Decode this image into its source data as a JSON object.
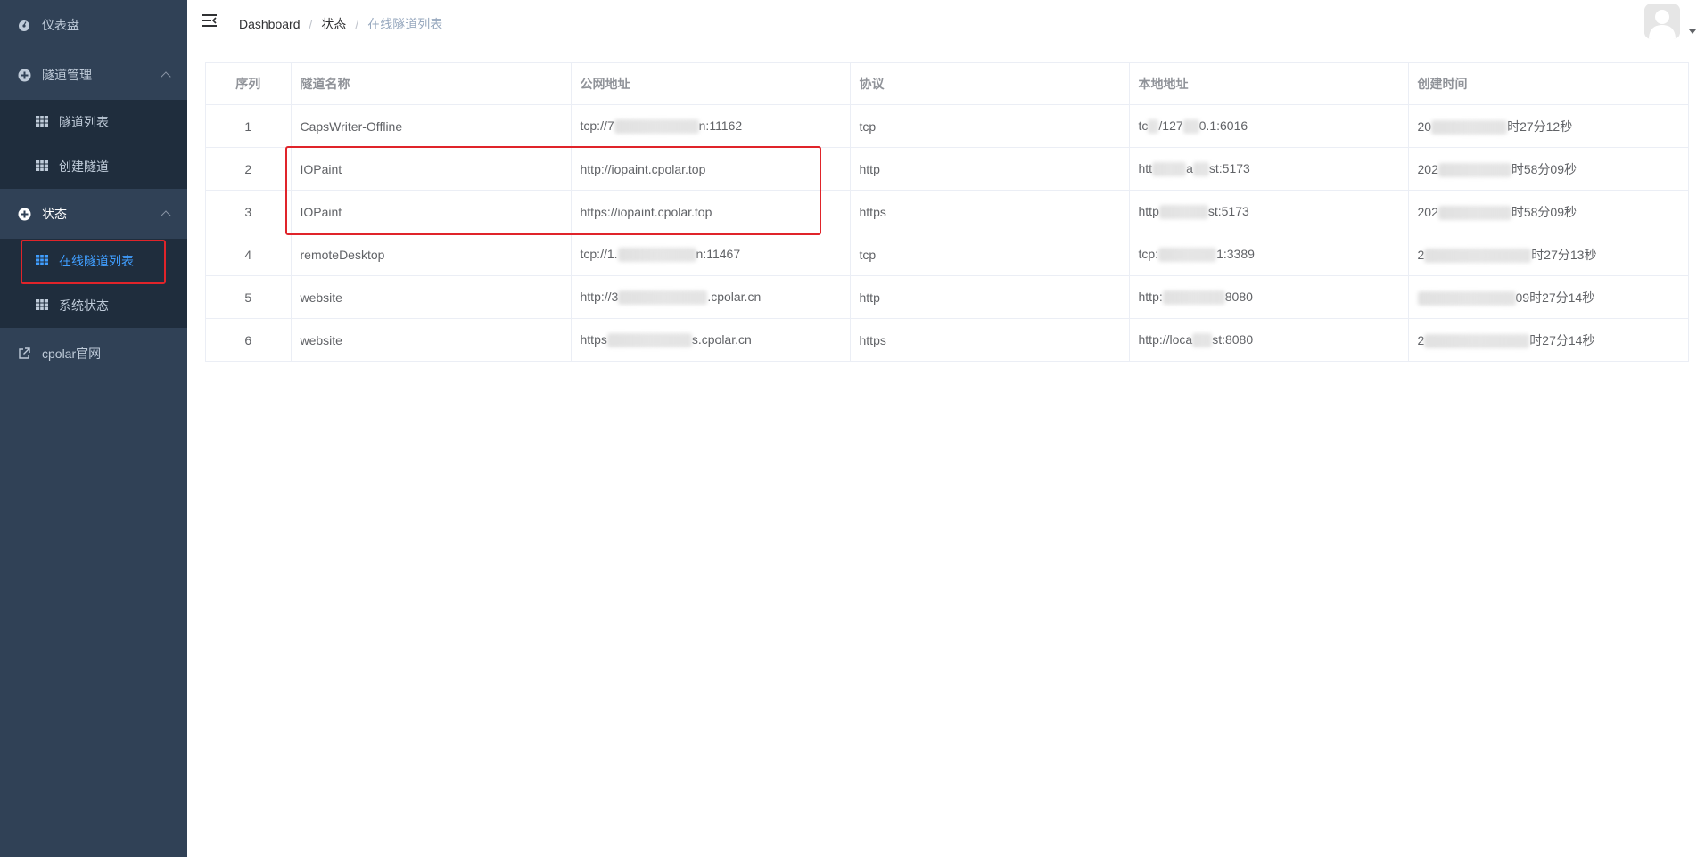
{
  "sidebar": {
    "items": [
      {
        "label": "仪表盘",
        "icon": "dashboard-icon"
      },
      {
        "label": "隧道管理",
        "icon": "plus-circle-icon"
      },
      {
        "label": "隧道列表",
        "icon": "table-icon"
      },
      {
        "label": "创建隧道",
        "icon": "table-icon"
      },
      {
        "label": "状态",
        "icon": "plus-circle-icon"
      },
      {
        "label": "在线隧道列表",
        "icon": "table-icon"
      },
      {
        "label": "系统状态",
        "icon": "table-icon"
      },
      {
        "label": "cpolar官网",
        "icon": "external-link-icon"
      }
    ],
    "active_item": "在线隧道列表",
    "bg_color": "#304156",
    "submenu_bg_color": "#1f2d3d",
    "active_color": "#409eff"
  },
  "header": {
    "breadcrumb": [
      "Dashboard",
      "状态",
      "在线隧道列表"
    ],
    "separator": "/"
  },
  "table": {
    "columns": [
      "序列",
      "隧道名称",
      "公网地址",
      "协议",
      "本地地址",
      "创建时间"
    ],
    "rows": [
      {
        "idx": "1",
        "name": "CapsWriter-Offline",
        "public_a": "tcp://7",
        "public_b": "n:11162",
        "protocol": "tcp",
        "local_a": "tc",
        "local_b": "/127",
        "local_c": "0.1:6016",
        "created_a": "20",
        "created_b": "时27分12秒"
      },
      {
        "idx": "2",
        "name": "IOPaint",
        "public_a": "http://iopaint.cpolar.top",
        "public_b": "",
        "protocol": "http",
        "local_a": "htt",
        "local_b": "a",
        "local_c": "st:5173",
        "created_a": "202",
        "created_b": "时58分09秒"
      },
      {
        "idx": "3",
        "name": "IOPaint",
        "public_a": "https://iopaint.cpolar.top",
        "public_b": "",
        "protocol": "https",
        "local_a": "http",
        "local_b": "",
        "local_c": "st:5173",
        "created_a": "202",
        "created_b": "时58分09秒"
      },
      {
        "idx": "4",
        "name": "remoteDesktop",
        "public_a": "tcp://1.",
        "public_b": "n:11467",
        "protocol": "tcp",
        "local_a": "tcp:",
        "local_b": "",
        "local_c": "1:3389",
        "created_a": "2",
        "created_b": "时27分13秒"
      },
      {
        "idx": "5",
        "name": "website",
        "public_a": "http://3",
        "public_b": ".cpolar.cn",
        "protocol": "http",
        "local_a": "http:",
        "local_b": "",
        "local_c": "8080",
        "created_a": "",
        "created_b": "09时27分14秒"
      },
      {
        "idx": "6",
        "name": "website",
        "public_a": "https",
        "public_b": "s.cpolar.cn",
        "protocol": "https",
        "local_a": "http://loca",
        "local_b": "",
        "local_c": "st:8080",
        "created_a": "2",
        "created_b": "时27分14秒"
      }
    ]
  },
  "highlight_color": "#e0242a"
}
